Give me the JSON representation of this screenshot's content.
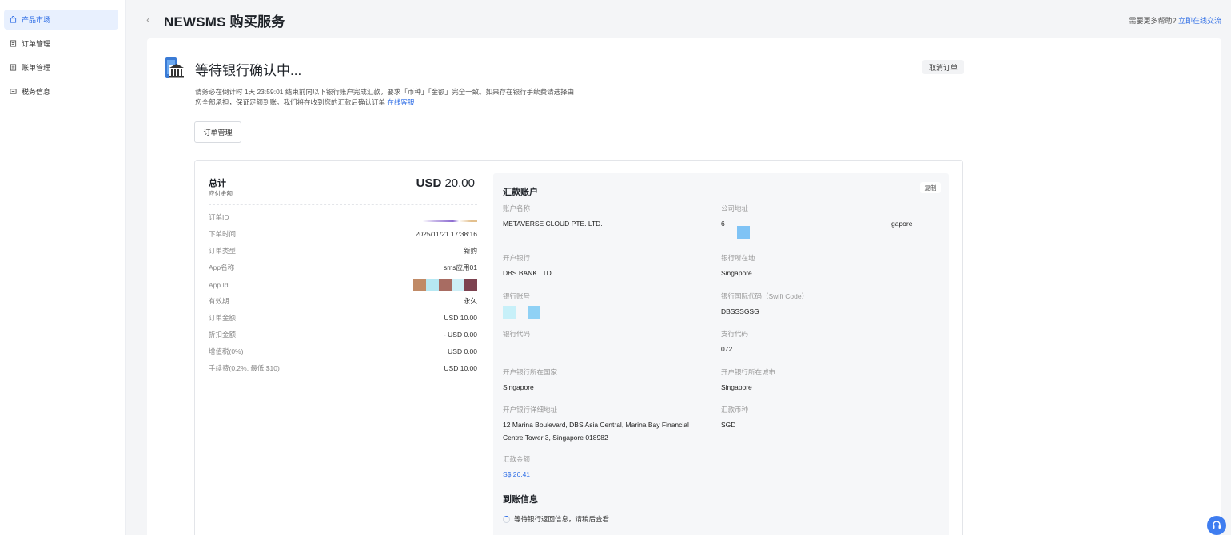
{
  "sidebar": {
    "items": [
      {
        "label": "产品市场",
        "icon": "bag-icon",
        "active": true
      },
      {
        "label": "订单管理",
        "icon": "order-icon",
        "active": false
      },
      {
        "label": "账单管理",
        "icon": "bill-icon",
        "active": false
      },
      {
        "label": "税务信息",
        "icon": "tax-icon",
        "active": false
      }
    ]
  },
  "header": {
    "title": "NEWSMS 购买服务",
    "help_text": "需要更多帮助?",
    "help_link": "立即在线交流"
  },
  "status": {
    "title": "等待银行确认中...",
    "cancel_label": "取消订单",
    "notice_line1": "请务必在倒计时 1天 23:59:01 结束前向以下银行账户完成汇款，要求「币种」「金额」完全一致。如果存在银行手续费请选择由",
    "notice_line2": "您全部承担，保证足额到账。我们将在收到您的汇款后确认订单",
    "notice_link": "在线客服",
    "order_btn": "订单管理"
  },
  "summary": {
    "title": "总计",
    "subtitle": "应付金额",
    "currency": "USD",
    "amount": "20.00",
    "rows": [
      {
        "k": "订单ID",
        "v": ""
      },
      {
        "k": "下单时间",
        "v": "2025/11/21 17:38:16"
      },
      {
        "k": "订单类型",
        "v": "新购"
      },
      {
        "k": "App名称",
        "v": "sms应用01"
      },
      {
        "k": "App Id",
        "v": ""
      },
      {
        "k": "有效期",
        "v": "永久"
      },
      {
        "k": "订单金额",
        "v": "USD 10.00"
      },
      {
        "k": "折扣金额",
        "v": "- USD 0.00"
      },
      {
        "k": "增值税(0%)",
        "v": "USD 0.00"
      },
      {
        "k": "手续费(0.2%, 最低 $10)",
        "v": "USD 10.00"
      }
    ]
  },
  "remittance": {
    "title": "汇款账户",
    "copy_label": "复制",
    "account_name_label": "账户名称",
    "account_name": "METAVERSE CLOUD PTE. LTD.",
    "company_address_label": "公司地址",
    "company_address_start": "6",
    "company_address_end": "gapore",
    "bank_label": "开户银行",
    "bank": "DBS BANK LTD",
    "bank_location_label": "银行所在地",
    "bank_location": "Singapore",
    "account_no_label": "银行账号",
    "swift_label": "银行国际代码（Swift Code）",
    "swift": "DBSSSGSG",
    "bank_code_label": "银行代码",
    "bank_code": "",
    "branch_code_label": "支行代码",
    "branch_code": "072",
    "bank_country_label": "开户银行所在国家",
    "bank_country": "Singapore",
    "bank_city_label": "开户银行所在城市",
    "bank_city": "Singapore",
    "bank_address_label": "开户银行详细地址",
    "bank_address_line1": "12 Marina Boulevard, DBS Asia Central, Marina Bay Financial",
    "bank_address_line2": "Centre Tower 3, Singapore 018982",
    "currency_label": "汇款币种",
    "currency": "SGD",
    "amount_label": "汇款金额",
    "amount": "S$ 26.41"
  },
  "arrival": {
    "title": "到账信息",
    "message": "等待银行返回信息，请稍后查看......"
  },
  "colors": {
    "accent": "#2f6ee6",
    "sidebar_active_bg": "#e8f0fe",
    "panel_bg": "#f6f7f9"
  }
}
